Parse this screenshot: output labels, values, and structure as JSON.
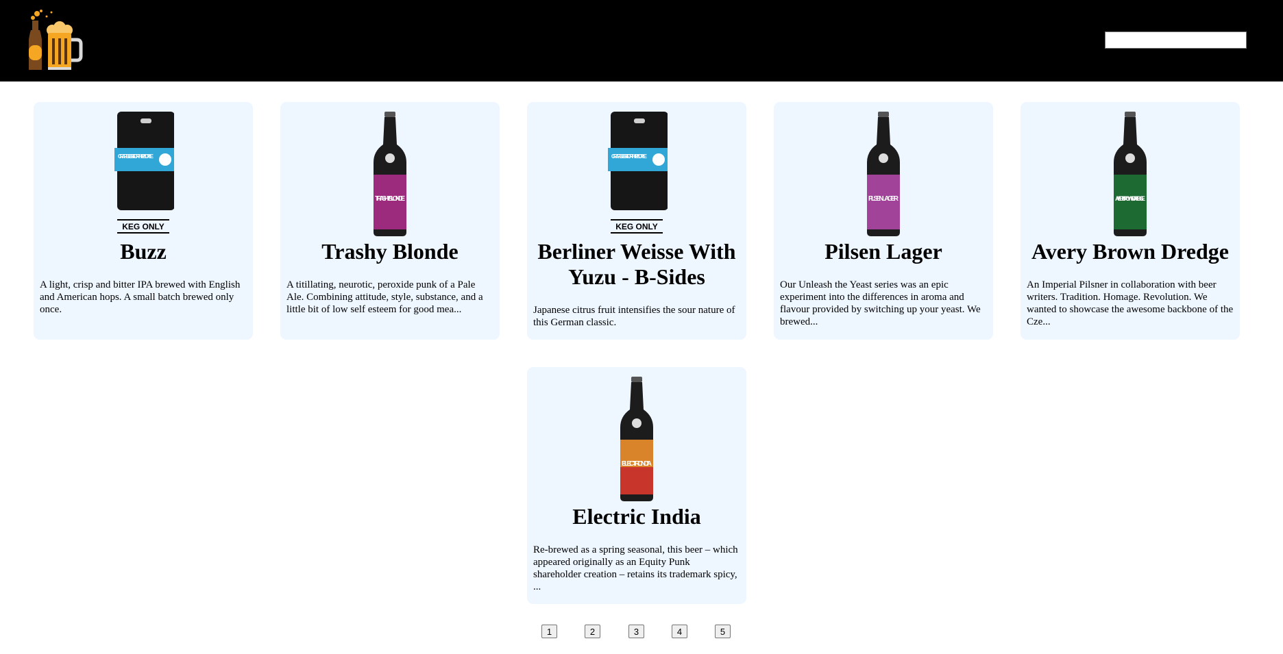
{
  "header": {
    "logo_icon": "beer-bottle-and-mug-icon",
    "search_value": "",
    "search_placeholder": ""
  },
  "beers": [
    {
      "name": "Buzz",
      "image": "keg-icon",
      "keg_label": "KEG ONLY",
      "keg_text": "CRAFT BEER FOR THE PEOPLE",
      "description": "A light, crisp and bitter IPA brewed with English and American hops. A small batch brewed only once."
    },
    {
      "name": "Trashy Blonde",
      "image": "beer-bottle-icon",
      "label_color": "#9c2b7e",
      "bottle_text": "TRASHY BLONDE",
      "description": "A titillating, neurotic, peroxide punk of a Pale Ale. Combining attitude, style, substance, and a little bit of low self esteem for good mea..."
    },
    {
      "name": "Berliner Weisse With Yuzu - B-Sides",
      "image": "keg-icon",
      "keg_label": "KEG ONLY",
      "keg_text": "CRAFT BEER FOR THE PEOPLE",
      "description": "Japanese citrus fruit intensifies the sour nature of this German classic."
    },
    {
      "name": "Pilsen Lager",
      "image": "beer-bottle-icon",
      "label_color": "#a2439a",
      "bottle_text": "PILSEN LAGER",
      "description": "Our Unleash the Yeast series was an epic experiment into the differences in aroma and flavour provided by switching up your yeast. We brewed..."
    },
    {
      "name": "Avery Brown Dredge",
      "image": "beer-bottle-icon",
      "label_color": "#1d6a33",
      "bottle_text": "AVERY BROWN DREDGE",
      "description": "An Imperial Pilsner in collaboration with beer writers. Tradition. Homage. Revolution. We wanted to showcase the awesome backbone of the Cze..."
    },
    {
      "name": "Electric India",
      "image": "beer-bottle-icon",
      "label_color": "#d9842a",
      "label_color_2": "#c8352b",
      "bottle_text": "ELECTRIC INDIA",
      "description": "Re-brewed as a spring seasonal, this beer – which appeared originally as an Equity Punk shareholder creation – retains its trademark spicy, ..."
    }
  ],
  "pagination": [
    "1",
    "2",
    "3",
    "4",
    "5"
  ]
}
